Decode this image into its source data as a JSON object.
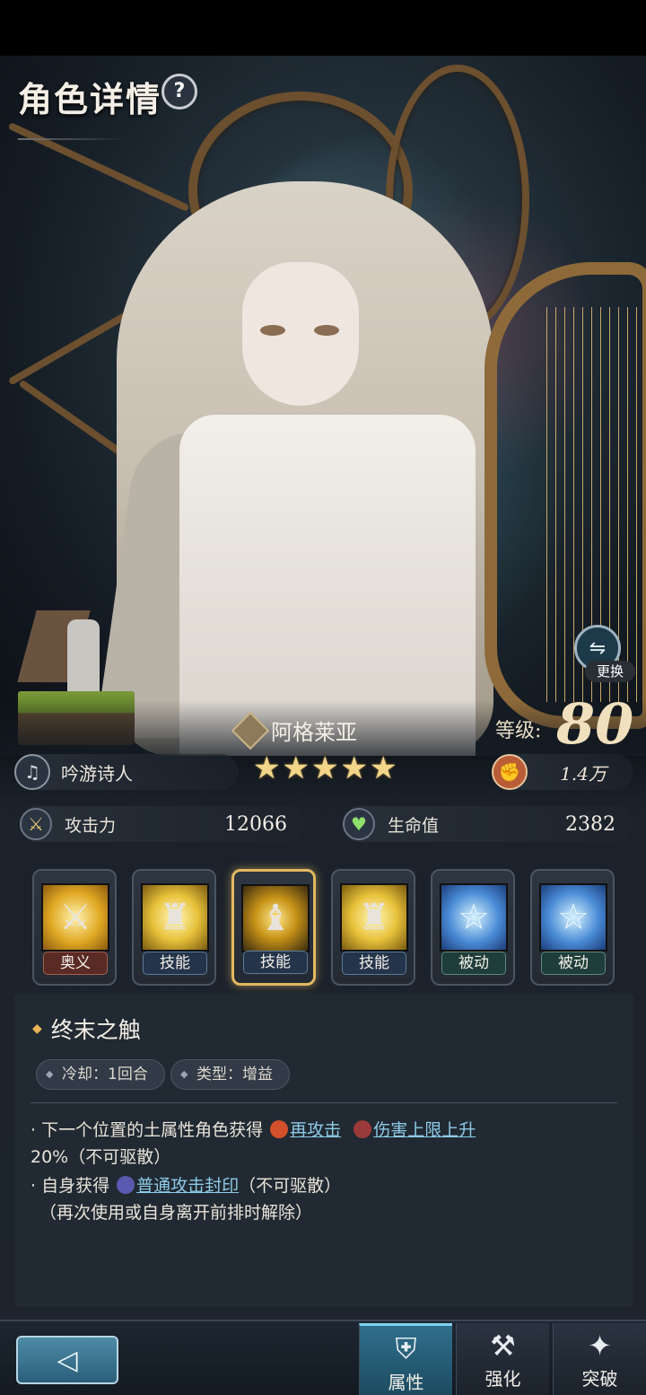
{
  "header": {
    "title": "角色详情",
    "help_symbol": "?"
  },
  "character": {
    "name": "阿格莱亚",
    "stars": [
      "★",
      "★",
      "★",
      "★",
      "★"
    ],
    "level_label": "等级:",
    "level": "80",
    "class_name": "吟游诗人",
    "power": "1.4万",
    "swap_label": "更换"
  },
  "stats": {
    "attack_label": "攻击力",
    "attack_value": "12066",
    "hp_label": "生命值",
    "hp_value": "2382"
  },
  "skills": [
    {
      "tag": "奥义",
      "selected": false
    },
    {
      "tag": "技能",
      "selected": false
    },
    {
      "tag": "技能",
      "selected": true
    },
    {
      "tag": "技能",
      "selected": false
    },
    {
      "tag": "被动",
      "selected": false
    },
    {
      "tag": "被动",
      "selected": false
    }
  ],
  "skill_detail": {
    "name": "终末之触",
    "cooldown": "冷却：1回合",
    "type": "类型：增益",
    "line1_prefix": "· 下一个位置的土属性角色获得",
    "kw1": "再攻击",
    "kw2": "伤害上限上升",
    "line2": "20%（不可驱散）",
    "line3_prefix": "· 自身获得",
    "kw3": "普通攻击封印",
    "line3_suffix": "（不可驱散）",
    "line4": "（再次使用或自身离开前排时解除）"
  },
  "bottom_nav": {
    "tabs": [
      {
        "label": "属性",
        "active": true
      },
      {
        "label": "强化",
        "active": false
      },
      {
        "label": "突破",
        "active": false
      }
    ]
  },
  "colors": {
    "accent_gold": "#e2b860",
    "keyword_blue": "#8ecbe8",
    "active_tab": "#2f6f8c"
  }
}
